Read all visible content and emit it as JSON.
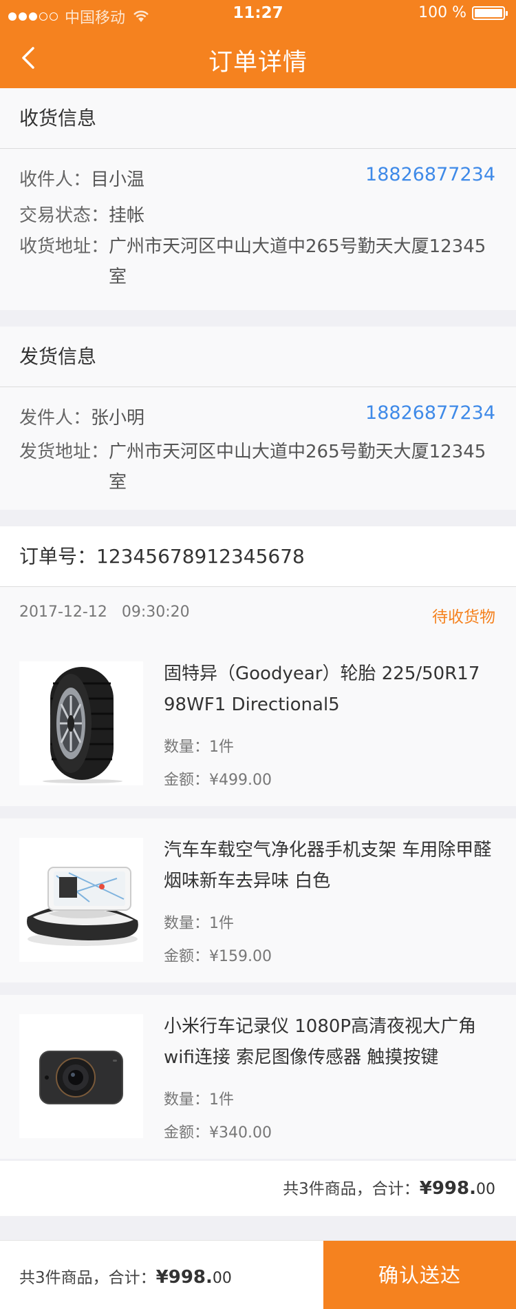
{
  "status_bar": {
    "carrier": "中国移动",
    "time": "11:27",
    "battery": "100 %"
  },
  "nav": {
    "title": "订单详情"
  },
  "receive": {
    "title": "收货信息",
    "receiver_label": "收件人：",
    "receiver_name": "目小温",
    "phone": "18826877234",
    "state_label": "交易状态：",
    "state_value": "挂帐",
    "address_label": "收货地址：",
    "address_value": "广州市天河区中山大道中265号勤天大厦12345室"
  },
  "ship": {
    "title": "发货信息",
    "sender_label": "发件人：",
    "sender_name": "张小明",
    "phone": "18826877234",
    "address_label": "发货地址：",
    "address_value": "广州市天河区中山大道中265号勤天大厦12345室"
  },
  "order": {
    "number_label": "订单号：",
    "number": "12345678912345678",
    "date": "2017-12-12   09:30:20",
    "status": "待收货物",
    "items": [
      {
        "name": "固特异（Goodyear）轮胎 225/50R17 98WF1 Directional5",
        "qty": "数量：1件",
        "amount": "金额：¥499.00",
        "image": "tire-image"
      },
      {
        "name": "汽车车载空气净化器手机支架 车用除甲醛烟味新车去异味 白色",
        "qty": "数量：1件",
        "amount": "金额：¥159.00",
        "image": "car-phone-holder-image"
      },
      {
        "name": "小米行车记录仪 1080P高清夜视大广角wifi连接 索尼图像传感器 触摸按键",
        "qty": "数量：1件",
        "amount": "金额：¥340.00",
        "image": "dashcam-image"
      }
    ],
    "summary_prefix": "共3件商品，合计：",
    "summary_big": "¥998.",
    "summary_small": "00"
  },
  "bottom": {
    "total_prefix": "共3件商品，合计：",
    "total_big": "¥998.",
    "total_small": "00",
    "confirm_label": "确认送达"
  },
  "colors": {
    "accent": "#f5821f",
    "phone": "#3f8ae8"
  }
}
